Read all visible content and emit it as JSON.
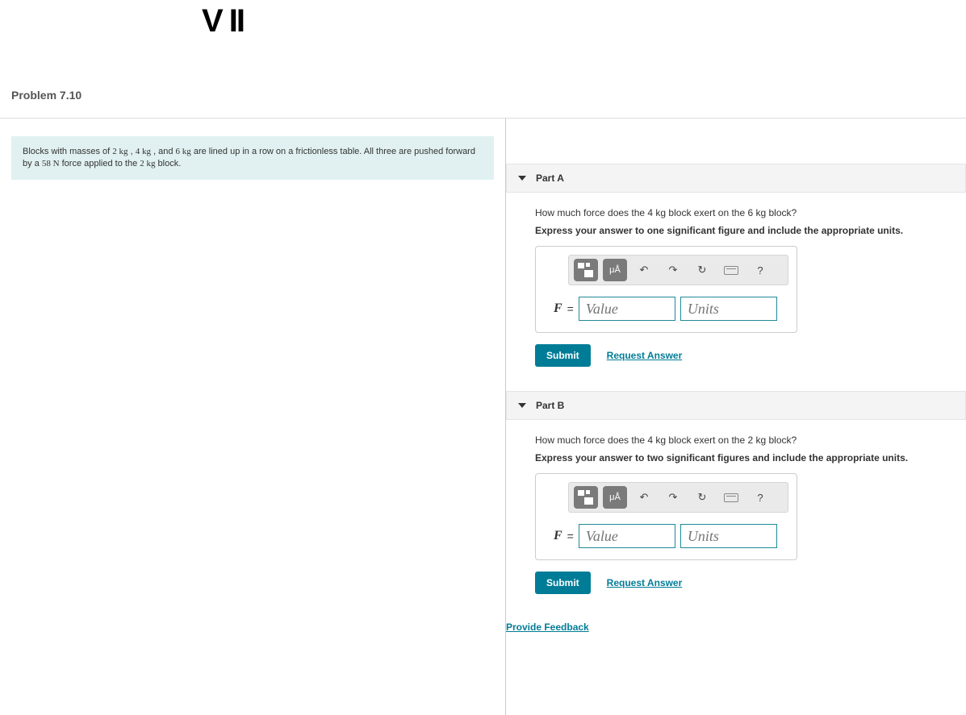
{
  "hand": "V II",
  "title": "Problem 7.10",
  "problem": {
    "t1": "Blocks with masses of ",
    "m1": "2 kg",
    "t2": " , ",
    "m2": "4 kg",
    "t3": " , and ",
    "m3": "6 kg",
    "t4": " are lined up in a row on a frictionless table. All three are pushed forward by a ",
    "force": "58 N",
    "t5": " force applied to the ",
    "m4": "2 kg",
    "t6": " block."
  },
  "parts": [
    {
      "label": "Part A",
      "question_a": "How much force does the ",
      "question_m1": "4 kg",
      "question_b": " block exert on the ",
      "question_m2": "6 kg",
      "question_c": " block?",
      "instruction": "Express your answer to one significant figure and include the appropriate units.",
      "eq_symbol": "F",
      "eq_equals": "=",
      "value_ph": "Value",
      "units_ph": "Units",
      "submit": "Submit",
      "request": "Request Answer"
    },
    {
      "label": "Part B",
      "question_a": "How much force does the ",
      "question_m1": "4 kg",
      "question_b": " block exert on the ",
      "question_m2": "2 kg",
      "question_c": " block?",
      "instruction": "Express your answer to two significant figures and include the appropriate units.",
      "eq_symbol": "F",
      "eq_equals": "=",
      "value_ph": "Value",
      "units_ph": "Units",
      "submit": "Submit",
      "request": "Request Answer"
    }
  ],
  "feedback": "Provide Feedback",
  "toolbar": {
    "special": "μÅ",
    "help": "?"
  }
}
